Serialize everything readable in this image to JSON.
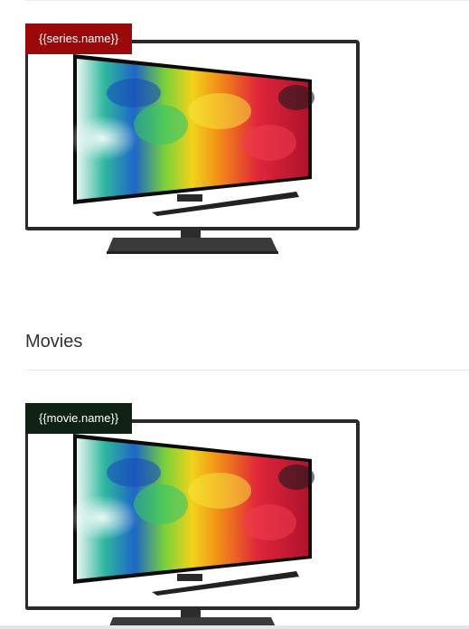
{
  "colors": {
    "series_badge": "#9b0a0a",
    "movie_badge": "#0f2314"
  },
  "series": {
    "badge_label": "{{series.name}}",
    "image_icon": "tv-image"
  },
  "movies": {
    "section_title": "Movies",
    "badge_label": "{{movie.name}}",
    "image_icon": "tv-image"
  }
}
